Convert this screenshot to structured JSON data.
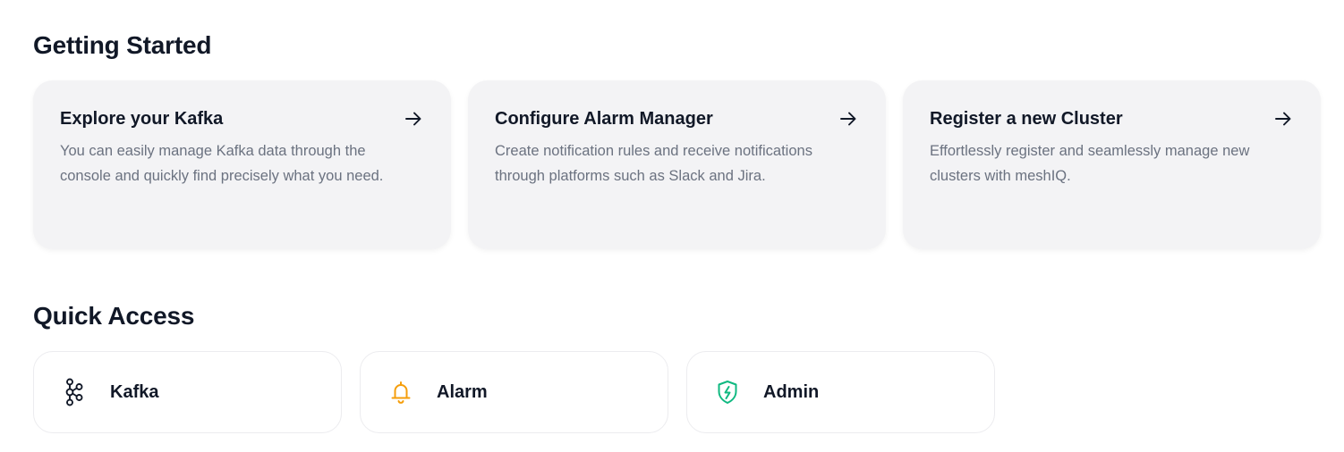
{
  "getting_started": {
    "title": "Getting Started",
    "cards": [
      {
        "title": "Explore your Kafka",
        "description": "You can easily manage Kafka data through the console and quickly find precisely what you need.",
        "icon": "arrow-right-icon"
      },
      {
        "title": "Configure Alarm Manager",
        "description": "Create notification rules and receive notifications through platforms such as Slack and Jira.",
        "icon": "arrow-right-icon"
      },
      {
        "title": "Register a new Cluster",
        "description": "Effortlessly register and seamlessly manage new clusters with meshIQ.",
        "icon": "arrow-right-icon"
      }
    ]
  },
  "quick_access": {
    "title": "Quick Access",
    "items": [
      {
        "label": "Kafka",
        "icon": "kafka-icon",
        "color": "#111827"
      },
      {
        "label": "Alarm",
        "icon": "bell-icon",
        "color": "#f59e0b"
      },
      {
        "label": "Admin",
        "icon": "shield-icon",
        "color": "#10b981"
      }
    ]
  }
}
